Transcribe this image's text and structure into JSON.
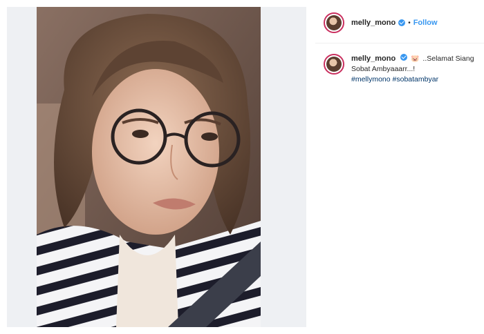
{
  "post": {
    "username": "melly_mono",
    "follow_label": "Follow",
    "separator": "•",
    "caption": {
      "emoji": "🐷",
      "line1": "..Selamat Siang",
      "line2": "Sobat Ambyaaarr...!",
      "hashtags": [
        "#mellymono",
        "#sobatambyar"
      ]
    }
  },
  "colors": {
    "verified": "#3897f0",
    "link": "#3897f0",
    "hashtag": "#003569",
    "avatar_ring": "#c92f5e"
  },
  "icons": {
    "verified": "verified-badge-icon"
  }
}
